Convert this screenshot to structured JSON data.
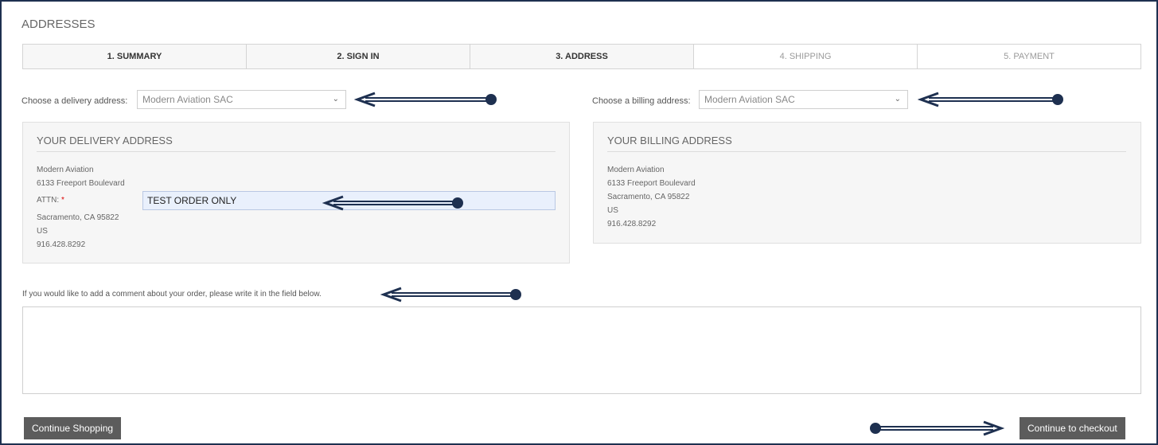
{
  "page": {
    "title": "ADDRESSES"
  },
  "steps": [
    {
      "label": "1. SUMMARY",
      "state": "done"
    },
    {
      "label": "2. SIGN IN",
      "state": "done"
    },
    {
      "label": "3. ADDRESS",
      "state": "done"
    },
    {
      "label": "4. SHIPPING",
      "state": "todo"
    },
    {
      "label": "5. PAYMENT",
      "state": "todo"
    }
  ],
  "delivery": {
    "choose_label": "Choose a delivery address:",
    "selected": "Modern Aviation SAC",
    "panel_title": "YOUR DELIVERY ADDRESS",
    "company": "Modern Aviation",
    "street": "6133 Freeport Boulevard",
    "attn_label": "ATTN:",
    "attn_required": "*",
    "attn_value": "TEST ORDER ONLY",
    "city": "Sacramento, CA 95822",
    "country": "US",
    "phone": "916.428.8292"
  },
  "billing": {
    "choose_label": "Choose a billing address:",
    "selected": "Modern Aviation SAC",
    "panel_title": "YOUR BILLING ADDRESS",
    "company": "Modern Aviation",
    "street": "6133 Freeport Boulevard",
    "city": "Sacramento, CA 95822",
    "country": "US",
    "phone": "916.428.8292"
  },
  "comment": {
    "label": "If you would like to add a comment about your order, please write it in the field below.",
    "value": ""
  },
  "buttons": {
    "continue_shopping": "Continue Shopping",
    "continue_checkout": "Continue to checkout"
  },
  "icons": {
    "select_chevron": "chevron-down-icon",
    "annotation_arrow": "arrow-icon"
  },
  "colors": {
    "frame_border": "#1e3050",
    "annotation": "#1e3050",
    "button": "#5c5c5c",
    "input_highlight": "#e9f0fc"
  }
}
